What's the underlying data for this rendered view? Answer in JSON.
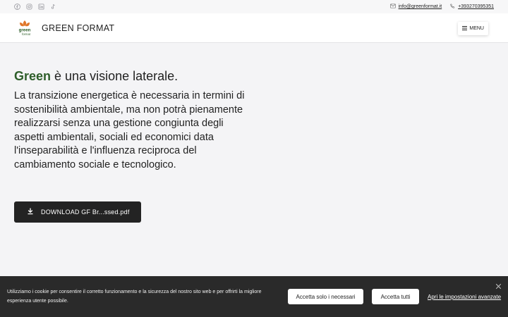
{
  "topbar": {
    "social_icons": [
      "facebook-icon",
      "instagram-icon",
      "linkedin-icon",
      "tiktok-icon"
    ],
    "email": "info@greenformat.it",
    "phone": "+393270395351"
  },
  "header": {
    "brand": "GREEN FORMAT",
    "logo_text_line1": "green",
    "logo_text_line2": "format",
    "menu_label": "MENU"
  },
  "main": {
    "headline_accent": "Green",
    "headline_rest": " è una visione laterale.",
    "lead": "La transizione energetica è necessaria in termini di sostenibilità ambientale, ma non potrà pienamente realizzarsi senza una gestione congiunta degli aspetti ambientali, sociali ed economici data l'inseparabilità e l'influenza reciproca del cambiamento sociale e tecnologico.",
    "download_label": "DOWNLOAD GF Br...ssed.pdf"
  },
  "cookie": {
    "text": "Utilizziamo i cookie per consentire il corretto funzionamento e la sicurezza del nostro sito web e per offrirti la migliore esperienza utente possibile.",
    "btn_necessary": "Accetta solo i necessari",
    "btn_all": "Accetta tutti",
    "link_advanced": "Apri le impostazioni avanzate"
  },
  "colors": {
    "accent_green": "#2e5e2a",
    "logo_orange": "#e0762a",
    "dark_button": "#232323",
    "cookie_bg": "#2a2a2a"
  }
}
